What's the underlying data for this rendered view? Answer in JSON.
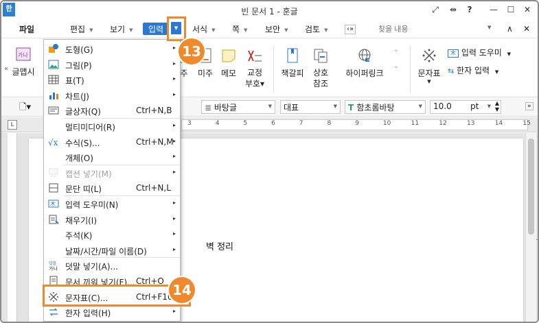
{
  "window": {
    "title": "빈 문서 1 - 훈글",
    "app_icon": "한",
    "controls": [
      "⤢",
      "⇹",
      "?",
      "—",
      "☐",
      "✕"
    ]
  },
  "menubar": {
    "items": [
      "파일",
      "편집",
      "보기",
      "입력",
      "서식",
      "쪽",
      "보안",
      "검토"
    ],
    "more": "‹»",
    "search_placeholder": "찾을 내용",
    "right_controls": [
      "∧",
      "✕"
    ]
  },
  "ribbon": {
    "left_label": "글맵시",
    "buttons": [
      {
        "label": "주",
        "icon": "footnote-icon"
      },
      {
        "label": "미주",
        "icon": "endnote-icon"
      },
      {
        "label": "메모",
        "icon": "memo-icon"
      },
      {
        "label": "교정\n부호",
        "icon": "proofreading-icon"
      },
      {
        "label": "책갈피",
        "icon": "bookmark-icon"
      },
      {
        "label": "상호\n참조",
        "icon": "cross-reference-icon"
      },
      {
        "label": "하이퍼링크",
        "icon": "hyperlink-icon"
      },
      {
        "label": "문자표",
        "icon": "symbol-icon"
      }
    ],
    "side_items": [
      "입력 도우미",
      "한자 입력"
    ]
  },
  "format_bar": {
    "style": "바탕글",
    "lang": "대표",
    "font": "함초롬바탕",
    "size": "10.0",
    "unit": "pt"
  },
  "ruler": {
    "labels": [
      "3",
      "4",
      "5",
      "6",
      "7",
      "8",
      "9",
      "10",
      "11",
      "12",
      "13",
      "14",
      "15"
    ]
  },
  "document": {
    "visible_text": "벽 정리"
  },
  "dropdown_menu": {
    "items": [
      {
        "label": "도형(G)",
        "shortcut": "",
        "submenu": true,
        "disabled": false,
        "icon": "shape-icon"
      },
      {
        "label": "그림(P)",
        "shortcut": "",
        "submenu": true,
        "disabled": false,
        "icon": "picture-icon"
      },
      {
        "label": "표(T)",
        "shortcut": "",
        "submenu": true,
        "disabled": false,
        "icon": "table-icon"
      },
      {
        "label": "차트(J)",
        "shortcut": "",
        "submenu": true,
        "disabled": false,
        "icon": "chart-icon"
      },
      {
        "label": "글상자(Q)",
        "shortcut": "Ctrl+N,B",
        "submenu": false,
        "disabled": false,
        "icon": "textbox-icon"
      },
      {
        "label": "멀티미디어(R)",
        "shortcut": "",
        "submenu": true,
        "disabled": false,
        "icon": ""
      },
      {
        "label": "수식(S)...",
        "shortcut": "Ctrl+N,M",
        "submenu": true,
        "disabled": false,
        "icon": "formula-icon"
      },
      {
        "label": "개체(O)",
        "shortcut": "",
        "submenu": true,
        "disabled": false,
        "icon": ""
      },
      {
        "label": "캡션 넣기(M)",
        "shortcut": "",
        "submenu": true,
        "disabled": true,
        "icon": "caption-icon"
      },
      {
        "label": "문단 띠(L)",
        "shortcut": "Ctrl+N,L",
        "submenu": false,
        "disabled": false,
        "icon": "paragraph-band-icon"
      },
      {
        "label": "입력 도우미(N)",
        "shortcut": "",
        "submenu": true,
        "disabled": false,
        "icon": "input-helper-icon"
      },
      {
        "label": "채우기(I)",
        "shortcut": "",
        "submenu": true,
        "disabled": false,
        "icon": "fill-icon"
      },
      {
        "label": "주석(K)",
        "shortcut": "",
        "submenu": true,
        "disabled": false,
        "icon": ""
      },
      {
        "label": "날짜/시간/파일 이름(D)",
        "shortcut": "",
        "submenu": true,
        "disabled": false,
        "icon": ""
      },
      {
        "label": "덧말 넣기(A)...",
        "shortcut": "",
        "submenu": false,
        "disabled": false,
        "icon": "ruby-text-icon"
      },
      {
        "label": "문서 끼워 넣기(F)...",
        "shortcut": "Ctrl+O",
        "submenu": false,
        "disabled": false,
        "icon": "insert-document-icon"
      },
      {
        "label": "문자표(C)...",
        "shortcut": "Ctrl+F10",
        "submenu": false,
        "disabled": false,
        "icon": "symbol-icon"
      },
      {
        "label": "한자 입력(H)",
        "shortcut": "",
        "submenu": true,
        "disabled": false,
        "icon": "hanja-icon"
      }
    ]
  },
  "callouts": [
    {
      "number": "13"
    },
    {
      "number": "14"
    }
  ],
  "colors": {
    "accent": "#2b78d2",
    "callout": "#ef8a2c"
  }
}
